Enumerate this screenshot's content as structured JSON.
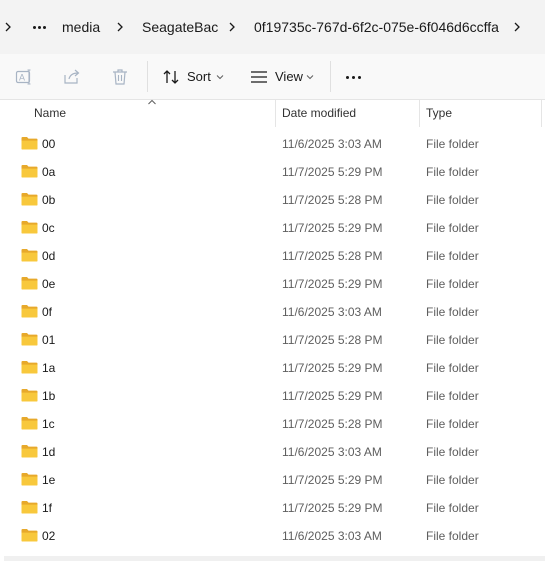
{
  "breadcrumb": {
    "segments": [
      "media",
      "SeagateBac",
      "0f19735c-767d-6f2c-075e-6f046d6ccffa"
    ]
  },
  "toolbar": {
    "sort_label": "Sort",
    "view_label": "View",
    "icons": [
      "rename-icon",
      "share-icon",
      "delete-icon",
      "sort-icon",
      "view-icon",
      "more-icon"
    ]
  },
  "columns": {
    "name": "Name",
    "date": "Date modified",
    "type": "Type"
  },
  "files": [
    {
      "name": "00",
      "date": "11/6/2025 3:03 AM",
      "type": "File folder"
    },
    {
      "name": "0a",
      "date": "11/7/2025 5:29 PM",
      "type": "File folder"
    },
    {
      "name": "0b",
      "date": "11/7/2025 5:28 PM",
      "type": "File folder"
    },
    {
      "name": "0c",
      "date": "11/7/2025 5:29 PM",
      "type": "File folder"
    },
    {
      "name": "0d",
      "date": "11/7/2025 5:28 PM",
      "type": "File folder"
    },
    {
      "name": "0e",
      "date": "11/7/2025 5:29 PM",
      "type": "File folder"
    },
    {
      "name": "0f",
      "date": "11/6/2025 3:03 AM",
      "type": "File folder"
    },
    {
      "name": "01",
      "date": "11/7/2025 5:28 PM",
      "type": "File folder"
    },
    {
      "name": "1a",
      "date": "11/7/2025 5:29 PM",
      "type": "File folder"
    },
    {
      "name": "1b",
      "date": "11/7/2025 5:29 PM",
      "type": "File folder"
    },
    {
      "name": "1c",
      "date": "11/7/2025 5:28 PM",
      "type": "File folder"
    },
    {
      "name": "1d",
      "date": "11/6/2025 3:03 AM",
      "type": "File folder"
    },
    {
      "name": "1e",
      "date": "11/7/2025 5:29 PM",
      "type": "File folder"
    },
    {
      "name": "1f",
      "date": "11/7/2025 5:29 PM",
      "type": "File folder"
    },
    {
      "name": "02",
      "date": "11/6/2025 3:03 AM",
      "type": "File folder"
    }
  ],
  "colors": {
    "folder": "#f8c83c",
    "folder_dark": "#e7a92b",
    "disabled_icon": "#a8b4c4"
  }
}
